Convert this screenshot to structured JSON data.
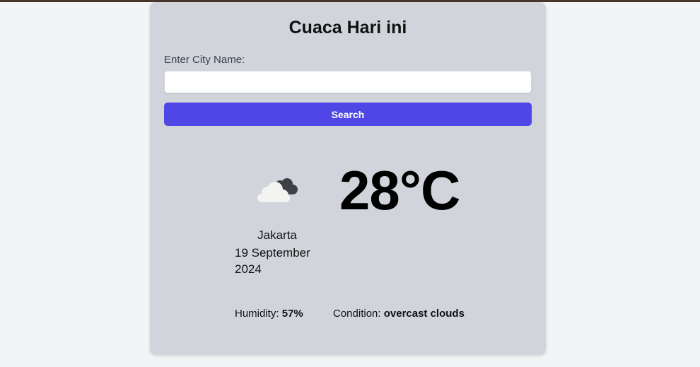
{
  "app": {
    "title": "Cuaca Hari ini"
  },
  "search": {
    "label": "Enter City Name:",
    "value": "",
    "placeholder": "",
    "button_label": "Search"
  },
  "weather": {
    "icon": "overcast-clouds-icon",
    "temperature": "28°C",
    "city": "Jakarta",
    "date": "19 September 2024",
    "humidity_label": "Humidity:",
    "humidity_value": "57%",
    "condition_label": "Condition:",
    "condition_value": "overcast clouds"
  },
  "colors": {
    "accent": "#4f46e5",
    "card_bg": "#d1d5db",
    "page_bg": "#f3f4f6",
    "topbar": "#4a3528"
  }
}
